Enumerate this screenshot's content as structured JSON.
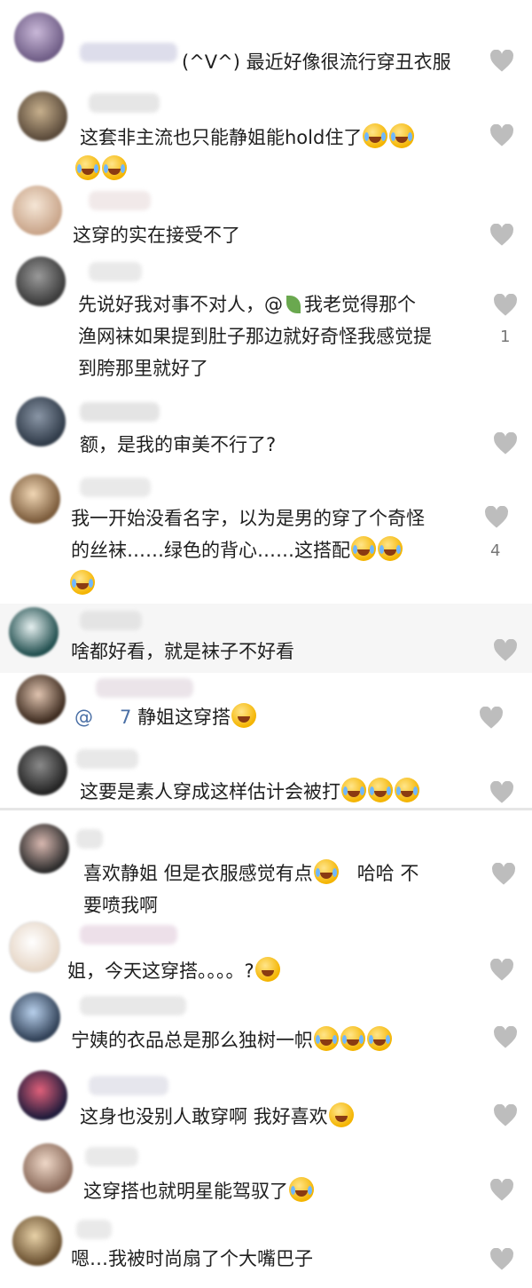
{
  "theme": {
    "heart_color": "#bdbdbd",
    "text_color": "#1f1f1f",
    "mention_color": "#4a6fa5",
    "emoji_color": "#f4b400"
  },
  "comments": [
    {
      "user": "(^V^)",
      "text": "最近好像很流行穿丑衣服",
      "likes": ""
    },
    {
      "user": "",
      "text": "这套非主流也只能静姐能hold住了",
      "likes": ""
    },
    {
      "user": "",
      "text": "这穿的实在接受不了",
      "likes": ""
    },
    {
      "user": "",
      "text_lines": [
        "先说好我对事不对人，@",
        "我老觉得那个",
        "渔网袜如果提到肚子那边就好奇怪我感觉提",
        "到胯那里就好了"
      ],
      "likes": "1"
    },
    {
      "user": "",
      "text": "额，是我的审美不行了?",
      "likes": ""
    },
    {
      "user": "",
      "text_lines": [
        "我一开始没看名字，以为是男的穿了个奇怪",
        "的丝袜……绿色的背心……这搭配"
      ],
      "likes": "4"
    },
    {
      "user": "",
      "text": "啥都好看，就是袜子不好看",
      "likes": ""
    },
    {
      "user": "",
      "mention": "@",
      "mention_suffix": "7",
      "text": "静姐这穿搭",
      "likes": ""
    },
    {
      "user": "",
      "text": "这要是素人穿成这样估计会被打",
      "likes": ""
    },
    {
      "user": "",
      "text_lines": [
        "喜欢静姐  但是衣服感觉有点",
        "哈哈  不",
        "要喷我啊"
      ],
      "likes": ""
    },
    {
      "user": "",
      "text": "姐，今天这穿搭。。。。?",
      "likes": ""
    },
    {
      "user": "",
      "text": "宁姨的衣品总是那么独树一帜",
      "likes": ""
    },
    {
      "user": "",
      "text": "这身也没别人敢穿啊 我好喜欢",
      "likes": ""
    },
    {
      "user": "",
      "text": "这穿搭也就明星能驾驭了",
      "likes": ""
    },
    {
      "user": "",
      "text": "嗯…我被时尚扇了个大嘴巴子",
      "likes": ""
    }
  ]
}
